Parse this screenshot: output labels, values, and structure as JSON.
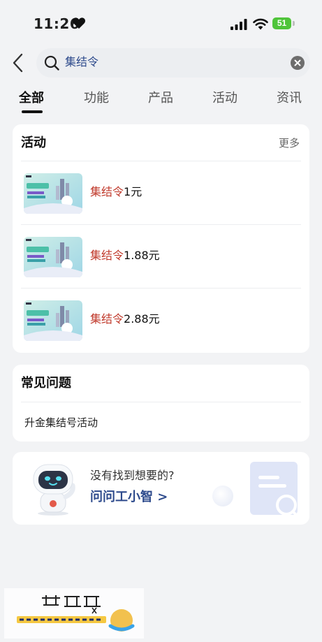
{
  "status_bar": {
    "time": "11:26",
    "battery": "51"
  },
  "search": {
    "value": "集结令"
  },
  "tabs": [
    {
      "label": "全部"
    },
    {
      "label": "功能"
    },
    {
      "label": "产品"
    },
    {
      "label": "活动"
    },
    {
      "label": "资讯"
    }
  ],
  "activity_section": {
    "title": "活动",
    "more": "更多",
    "items": [
      {
        "highlight": "集结令",
        "suffix": "1元"
      },
      {
        "highlight": "集结令",
        "suffix": "1.88元"
      },
      {
        "highlight": "集结令",
        "suffix": "2.88元"
      }
    ]
  },
  "faq_section": {
    "title": "常见问题",
    "items": [
      {
        "label": "升金集结号活动"
      }
    ]
  },
  "help_card": {
    "line1": "没有找到想要的?",
    "link": "问问工小智 >"
  },
  "colors": {
    "accent": "#2d4a8c",
    "highlight": "#c0392b",
    "background": "#f2f3f5"
  }
}
